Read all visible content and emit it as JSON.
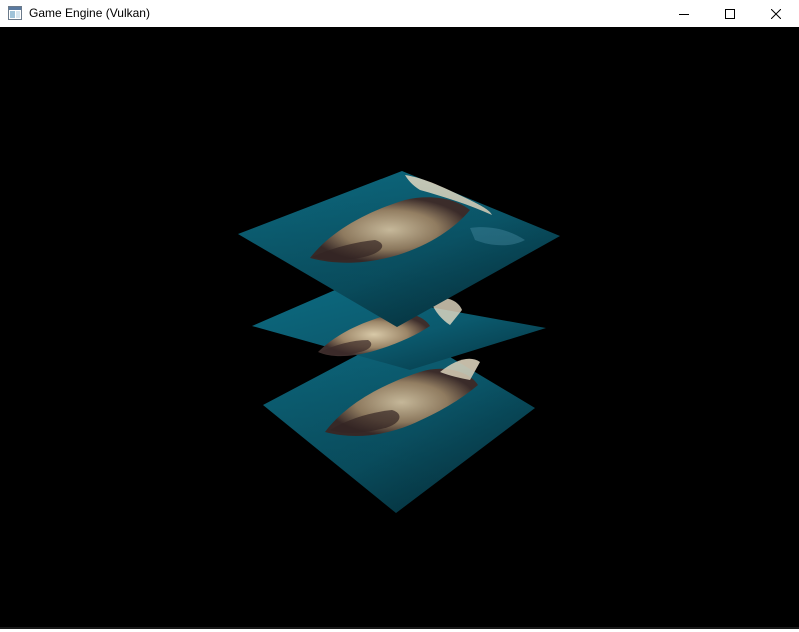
{
  "window": {
    "title": "Game Engine (Vulkan)",
    "icon": "app-window-icon",
    "controls": {
      "minimize_icon": "minimize-icon",
      "maximize_icon": "maximize-icon",
      "close_icon": "close-icon"
    }
  },
  "viewport": {
    "background": "#000000",
    "scene": {
      "object": "three stacked textured quads",
      "quad_count": 3,
      "texture_colors": {
        "water": "#0c5e73",
        "water_dark": "#06303d",
        "rock_light": "#c8b89a",
        "rock_dark": "#4a3a3a"
      }
    }
  }
}
